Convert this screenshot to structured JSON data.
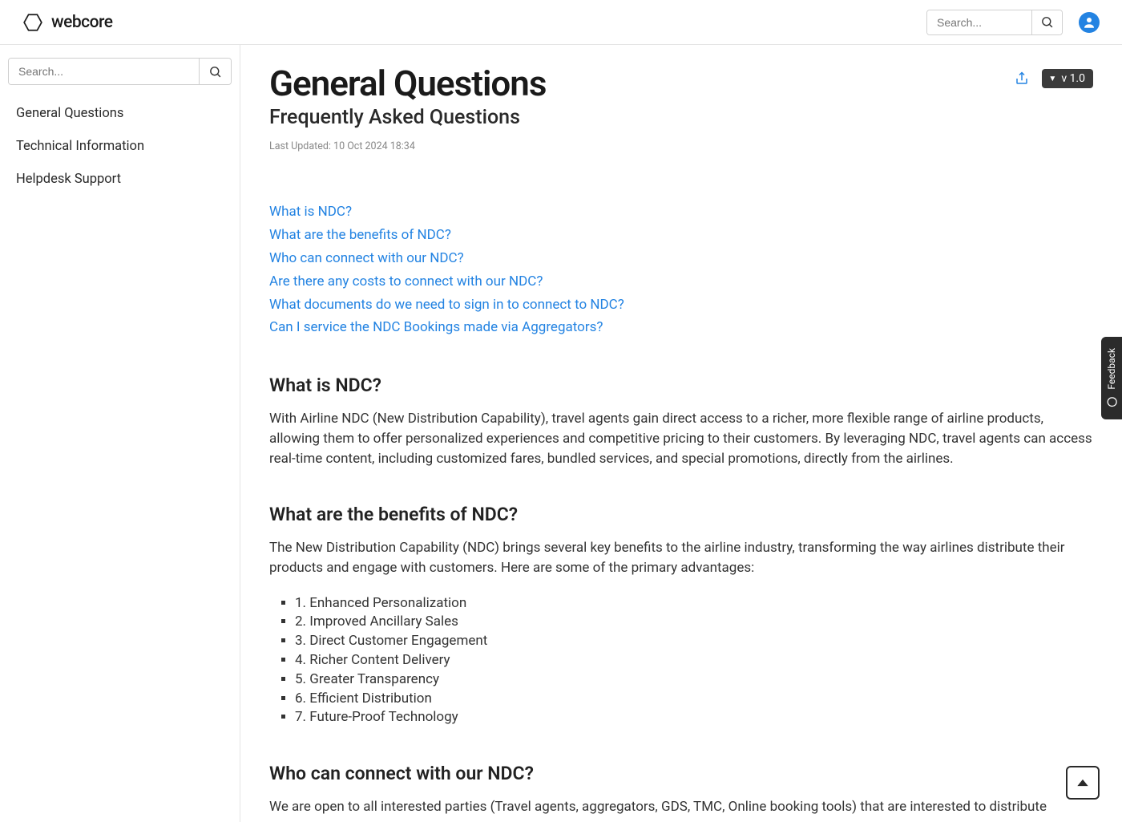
{
  "brand": "webcore",
  "header_search_placeholder": "Search...",
  "sidebar_search_placeholder": "Search...",
  "nav": [
    "General Questions",
    "Technical Information",
    "Helpdesk Support"
  ],
  "page_title": "General Questions",
  "subtitle": "Frequently Asked Questions",
  "updated": "Last Updated: 10 Oct 2024 18:34",
  "version": "v 1.0",
  "toc": [
    "What is NDC?",
    "What are the benefits of NDC?",
    "Who can connect with our NDC?",
    "Are there any costs to connect with our NDC?",
    "What documents do we need to sign in to connect to NDC?",
    "Can I service the NDC Bookings made via Aggregators?"
  ],
  "section1": {
    "heading": "What is NDC?",
    "body": "With Airline NDC (New Distribution Capability), travel agents gain direct access to a richer, more flexible range of airline products, allowing them to offer personalized experiences and competitive pricing to their customers. By leveraging NDC, travel agents can access real-time content, including customized fares, bundled services, and special promotions, directly from the airlines."
  },
  "section2": {
    "heading": "What are the benefits of NDC?",
    "body": "The New Distribution Capability (NDC) brings several key benefits to the airline industry, transforming the way airlines distribute their products and engage with customers. Here are some of the primary advantages:",
    "items": [
      "1. Enhanced Personalization",
      "2. Improved Ancillary Sales",
      "3. Direct Customer Engagement",
      "4. Richer Content Delivery",
      "5. Greater Transparency",
      "6. Efficient Distribution",
      "7. Future-Proof Technology"
    ]
  },
  "section3": {
    "heading": "Who can connect with our NDC?",
    "body": "We are open to all interested parties (Travel agents, aggregators, GDS, TMC, Online booking tools) that are interested to distribute"
  },
  "feedback_label": "Feedback"
}
